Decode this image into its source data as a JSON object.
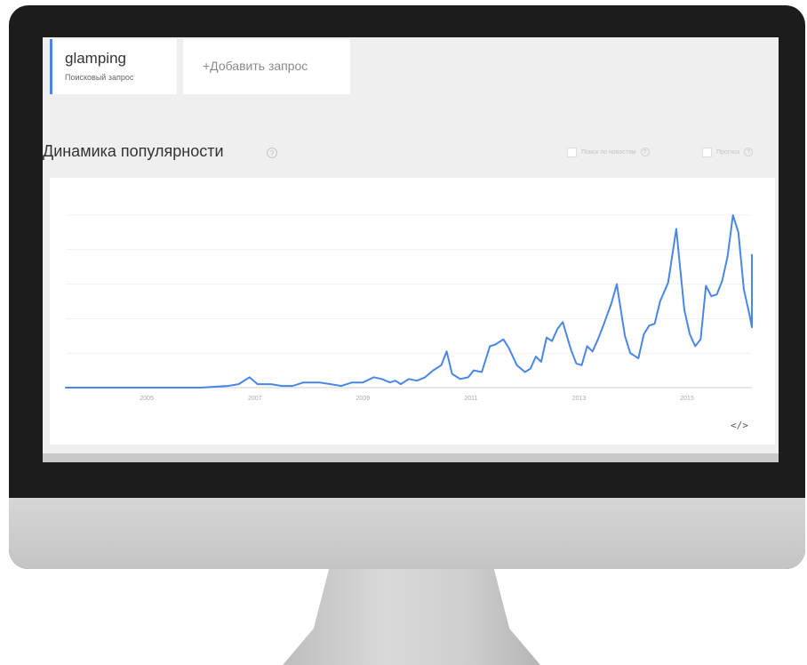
{
  "query": {
    "term": "glamping",
    "subtitle": "Поисковый запрос"
  },
  "add_query_label": "+Добавить запрос",
  "section": {
    "title": "Динамика популярности",
    "help": "?"
  },
  "options": [
    {
      "label": "Поиск по новостям",
      "help": "?",
      "checked": false
    },
    {
      "label": "Прогноз",
      "help": "?",
      "checked": false
    }
  ],
  "embed_icon": "</>",
  "colors": {
    "line": "#4a86e8",
    "accent": "#4a86e8"
  },
  "chart_data": {
    "type": "line",
    "title": "",
    "xlabel": "",
    "ylabel": "",
    "x_ticks": [
      "2005",
      "2007",
      "2009",
      "2011",
      "2013",
      "2015"
    ],
    "xlim": [
      2004.0,
      2016.7
    ],
    "ylim": [
      0,
      100
    ],
    "grid": true,
    "series": [
      {
        "values": [
          [
            2004.0,
            0
          ],
          [
            2006.5,
            0
          ],
          [
            2007.0,
            1
          ],
          [
            2007.2,
            2
          ],
          [
            2007.4,
            6
          ],
          [
            2007.55,
            2
          ],
          [
            2007.8,
            2
          ],
          [
            2008.0,
            1
          ],
          [
            2008.2,
            1
          ],
          [
            2008.4,
            3
          ],
          [
            2008.7,
            3
          ],
          [
            2008.9,
            2
          ],
          [
            2009.1,
            1
          ],
          [
            2009.3,
            3
          ],
          [
            2009.5,
            3
          ],
          [
            2009.7,
            6
          ],
          [
            2009.85,
            5
          ],
          [
            2010.0,
            3
          ],
          [
            2010.1,
            4
          ],
          [
            2010.2,
            2
          ],
          [
            2010.35,
            5
          ],
          [
            2010.5,
            4
          ],
          [
            2010.65,
            6
          ],
          [
            2010.8,
            10
          ],
          [
            2010.95,
            13
          ],
          [
            2011.05,
            21
          ],
          [
            2011.15,
            8
          ],
          [
            2011.3,
            5
          ],
          [
            2011.45,
            6
          ],
          [
            2011.55,
            10
          ],
          [
            2011.7,
            9
          ],
          [
            2011.85,
            24
          ],
          [
            2011.95,
            25
          ],
          [
            2012.1,
            28
          ],
          [
            2012.2,
            23
          ],
          [
            2012.35,
            13
          ],
          [
            2012.5,
            9
          ],
          [
            2012.6,
            11
          ],
          [
            2012.7,
            18
          ],
          [
            2012.8,
            15
          ],
          [
            2012.9,
            29
          ],
          [
            2013.0,
            27
          ],
          [
            2013.1,
            34
          ],
          [
            2013.2,
            38
          ],
          [
            2013.35,
            22
          ],
          [
            2013.45,
            14
          ],
          [
            2013.55,
            13
          ],
          [
            2013.65,
            24
          ],
          [
            2013.75,
            21
          ],
          [
            2013.85,
            28
          ],
          [
            2013.95,
            36
          ],
          [
            2014.1,
            49
          ],
          [
            2014.2,
            60
          ],
          [
            2014.35,
            30
          ],
          [
            2014.45,
            20
          ],
          [
            2014.6,
            17
          ],
          [
            2014.7,
            31
          ],
          [
            2014.8,
            36
          ],
          [
            2014.9,
            37
          ],
          [
            2015.0,
            50
          ],
          [
            2015.15,
            61
          ],
          [
            2015.3,
            92
          ],
          [
            2015.45,
            45
          ],
          [
            2015.55,
            31
          ],
          [
            2015.65,
            24
          ],
          [
            2015.75,
            28
          ],
          [
            2015.85,
            59
          ],
          [
            2015.95,
            53
          ],
          [
            2016.05,
            54
          ],
          [
            2016.15,
            62
          ],
          [
            2016.25,
            76
          ],
          [
            2016.35,
            100
          ],
          [
            2016.45,
            90
          ],
          [
            2016.55,
            57
          ],
          [
            2016.65,
            43
          ],
          [
            2016.75,
            35
          ],
          [
            2016.85,
            36
          ],
          [
            2016.95,
            66
          ],
          [
            2017.05,
            58
          ],
          [
            2017.15,
            77
          ],
          [
            2017.25,
            75
          ]
        ]
      }
    ]
  }
}
